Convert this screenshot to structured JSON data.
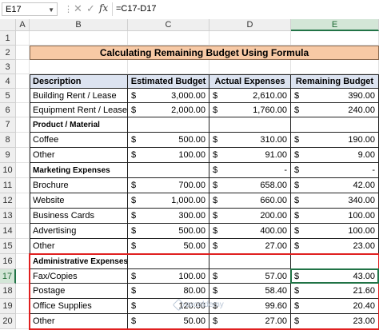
{
  "formula_bar": {
    "name_box": "E17",
    "fx_label": "fx",
    "formula": "=C17-D17"
  },
  "columns": [
    "A",
    "B",
    "C",
    "D",
    "E"
  ],
  "rows": [
    "1",
    "2",
    "3",
    "4",
    "5",
    "6",
    "7",
    "8",
    "9",
    "10",
    "11",
    "12",
    "13",
    "14",
    "15",
    "16",
    "17",
    "18",
    "19",
    "20"
  ],
  "selected_cell": "E17",
  "sheet": {
    "title": "Calculating Remaining Budget Using Formula",
    "headers": [
      "Description",
      "Estimated Budget",
      "Actual Expenses",
      "Remaining Budget"
    ],
    "currency": "$",
    "dash": "-",
    "items": [
      {
        "row": "5",
        "kind": "item",
        "desc": "Building Rent / Lease",
        "est": "3,000.00",
        "act": "2,610.00",
        "rem": "390.00"
      },
      {
        "row": "6",
        "kind": "item",
        "desc": "Equipment Rent / Lease",
        "est": "2,000.00",
        "act": "1,760.00",
        "rem": "240.00"
      },
      {
        "row": "7",
        "kind": "category",
        "desc": "Product / Material"
      },
      {
        "row": "8",
        "kind": "item",
        "desc": "Coffee",
        "est": "500.00",
        "act": "310.00",
        "rem": "190.00"
      },
      {
        "row": "9",
        "kind": "item",
        "desc": "Other",
        "est": "100.00",
        "act": "91.00",
        "rem": "9.00"
      },
      {
        "row": "10",
        "kind": "category",
        "desc": "Marketing Expenses",
        "act": "-",
        "rem": "-"
      },
      {
        "row": "11",
        "kind": "item",
        "desc": "Brochure",
        "est": "700.00",
        "act": "658.00",
        "rem": "42.00"
      },
      {
        "row": "12",
        "kind": "item",
        "desc": "Website",
        "est": "1,000.00",
        "act": "660.00",
        "rem": "340.00"
      },
      {
        "row": "13",
        "kind": "item",
        "desc": "Business Cards",
        "est": "300.00",
        "act": "200.00",
        "rem": "100.00"
      },
      {
        "row": "14",
        "kind": "item",
        "desc": "Advertising",
        "est": "500.00",
        "act": "400.00",
        "rem": "100.00"
      },
      {
        "row": "15",
        "kind": "item",
        "desc": "Other",
        "est": "50.00",
        "act": "27.00",
        "rem": "23.00"
      },
      {
        "row": "16",
        "kind": "category",
        "desc": "Administrative Expenses"
      },
      {
        "row": "17",
        "kind": "item",
        "desc": "Fax/Copies",
        "est": "100.00",
        "act": "57.00",
        "rem": "43.00"
      },
      {
        "row": "18",
        "kind": "item",
        "desc": "Postage",
        "est": "80.00",
        "act": "58.40",
        "rem": "21.60"
      },
      {
        "row": "19",
        "kind": "item",
        "desc": "Office Supplies",
        "est": "120.00",
        "act": "99.60",
        "rem": "20.40"
      },
      {
        "row": "20",
        "kind": "item",
        "desc": "Other",
        "est": "50.00",
        "act": "27.00",
        "rem": "23.00"
      }
    ]
  },
  "watermark": {
    "text": "exceldemy",
    "icon": "exceldemy-logo-icon"
  },
  "colors": {
    "title_fill": "#f7c9a5",
    "header_fill": "#dce3f0",
    "highlight_border": "#e02020",
    "selection_green": "#217346"
  }
}
